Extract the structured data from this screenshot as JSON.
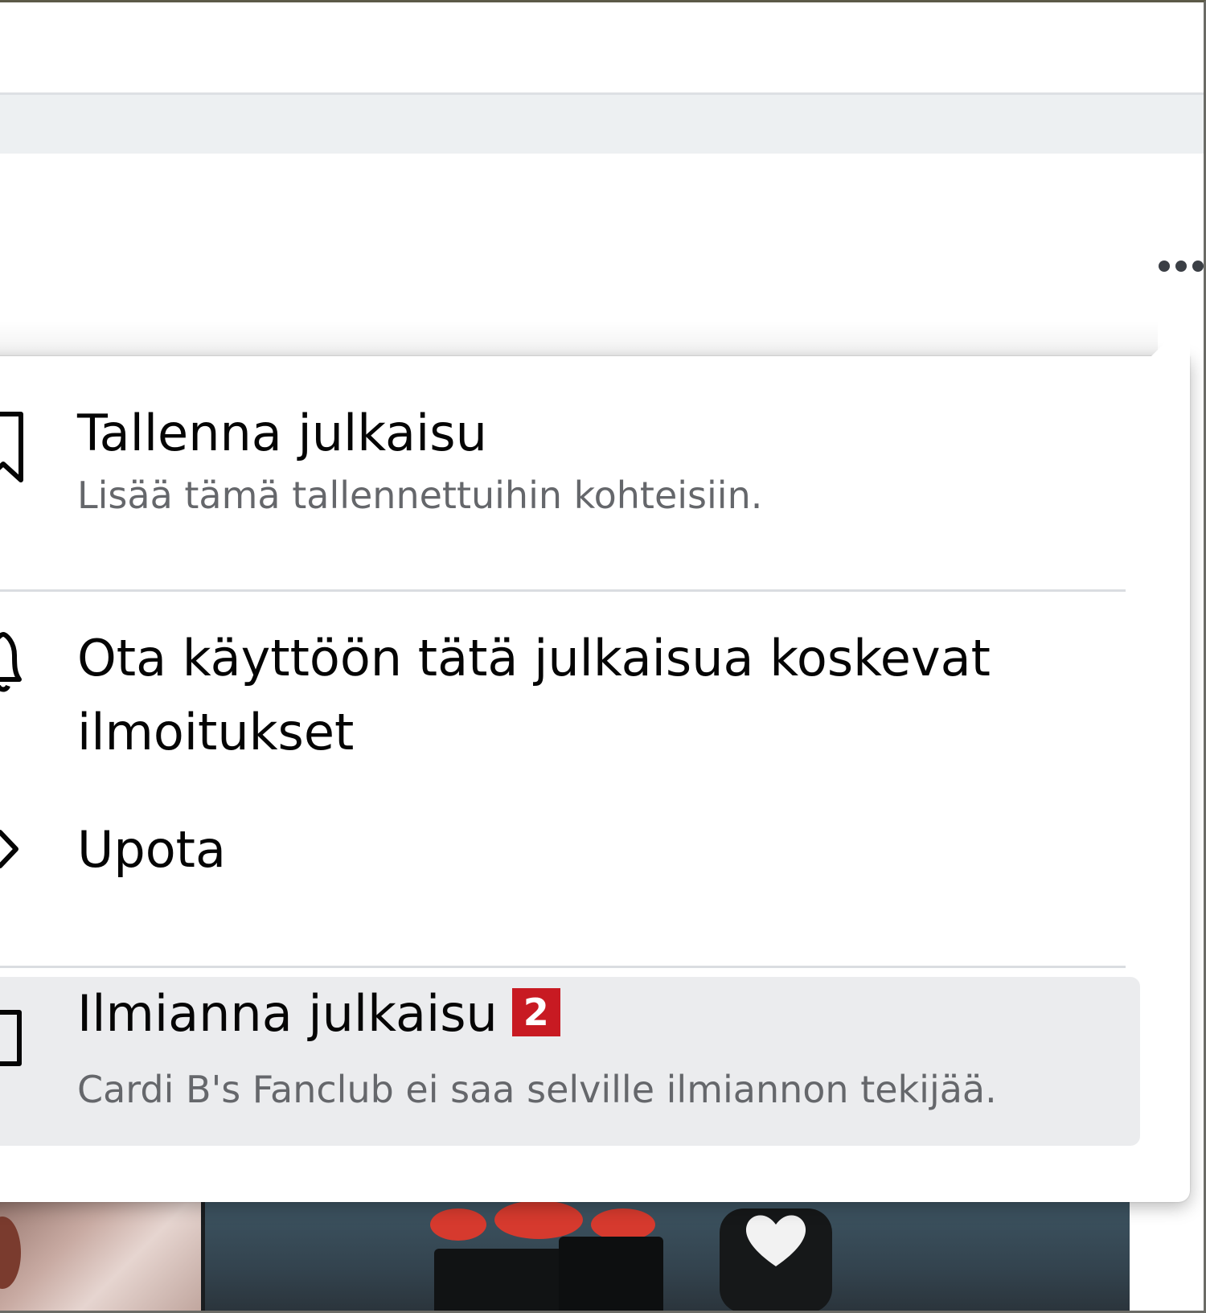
{
  "menu": {
    "items": [
      {
        "title": "Tallenna julkaisu",
        "subtitle": "Lisää tämä tallennettuihin kohteisiin.",
        "icon": "bookmark-icon"
      },
      {
        "title": "Ota käyttöön tätä julkaisua koskevat ilmoitukset",
        "icon": "bell-icon"
      },
      {
        "title": "Upota",
        "icon": "code-icon"
      },
      {
        "title": "Ilmianna julkaisu",
        "subtitle": "Cardi B's Fanclub ei saa selville ilmiannon tekijää.",
        "icon": "flag-icon",
        "badge": "2"
      }
    ]
  },
  "post": {
    "more_icon": "more-horizontal-icon"
  },
  "colors": {
    "badge": "#c81a22",
    "highlight": "#ebecee",
    "text": "#050505",
    "subtext": "#65676b"
  }
}
